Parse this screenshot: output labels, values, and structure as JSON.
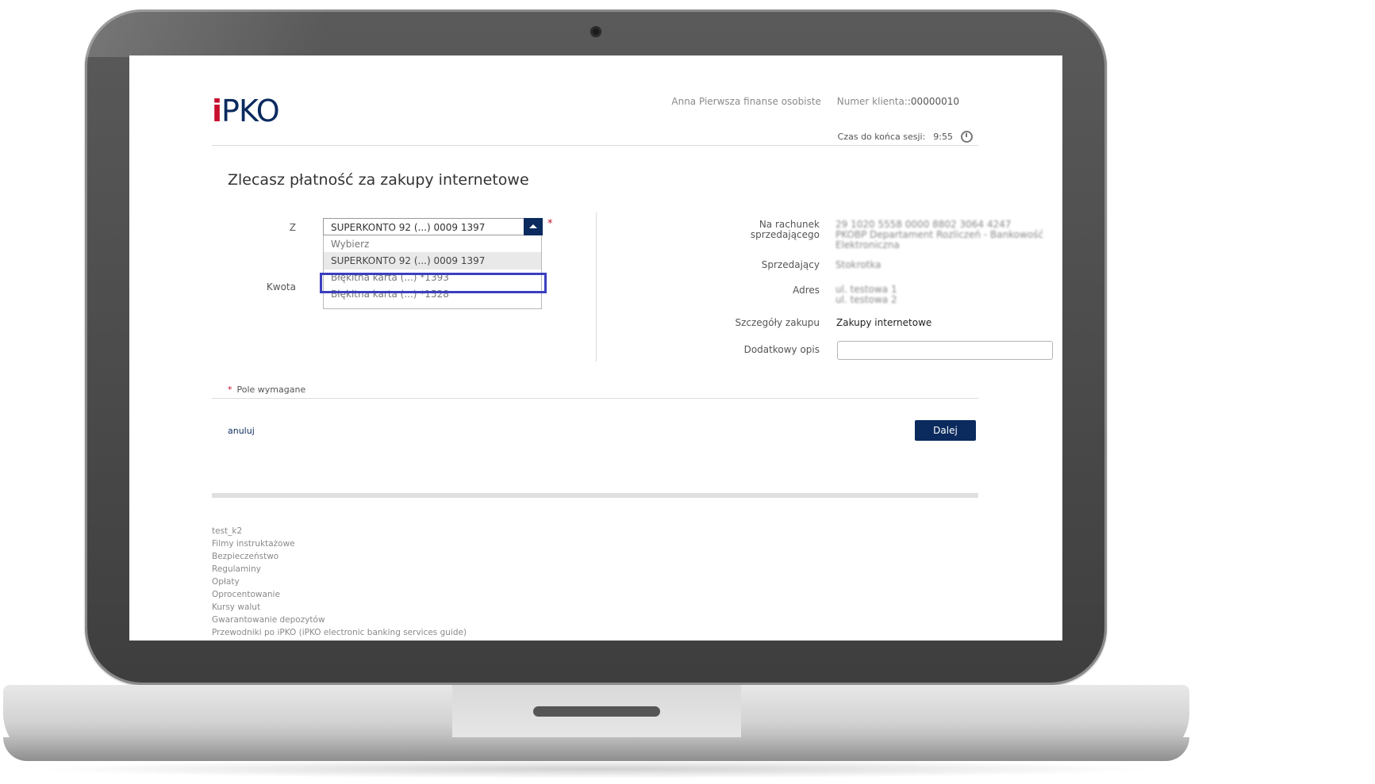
{
  "header": {
    "logo_i": "i",
    "logo_rest": "PKO",
    "user_name": "Anna Pierwsza finanse osobiste",
    "client_label": "Numer klienta:",
    "client_number": ":00000010",
    "session_label": "Czas do końca sesji:",
    "session_time": "9:55"
  },
  "main": {
    "title": "Zlecasz płatność za zakupy internetowe",
    "from_label": "Z",
    "amount_label": "Kwota",
    "selected_account": "SUPERKONTO 92 (...) 0009 1397",
    "required_star": "*",
    "dropdown_options": [
      {
        "label": "Wybierz"
      },
      {
        "label": "SUPERKONTO 92 (...) 0009 1397"
      },
      {
        "label": "Błękitna karta (...) *1393"
      },
      {
        "label": "Błękitna karta (...) *1528"
      }
    ]
  },
  "details": {
    "account_label_1": "Na rachunek",
    "account_label_2": "sprzedającego",
    "account_number": "29 1020 5558 0000 8802 3064 4247",
    "account_bank": "PKOBP Departament Rozliczeń - Bankowość Elektroniczna",
    "seller_label": "Sprzedający",
    "seller_value": "Stokrotka",
    "address_label": "Adres",
    "address_1": "ul. testowa 1",
    "address_2": "ul. testowa 2",
    "purchase_label": "Szczegóły zakupu",
    "purchase_value": "Zakupy internetowe",
    "desc_label": "Dodatkowy opis",
    "desc_value": ""
  },
  "form_footer": {
    "required_star": "*",
    "required_note": "Pole wymagane",
    "cancel_label": "anuluj",
    "next_label": "Dalej"
  },
  "footer_links": [
    "test_k2",
    "Filmy instruktażowe",
    "Bezpieczeństwo",
    "Regulaminy",
    "Opłaty",
    "Oprocentowanie",
    "Kursy walut",
    "Gwarantowanie depozytów",
    "Przewodniki po iPKO (iPKO electronic banking services guide)"
  ]
}
